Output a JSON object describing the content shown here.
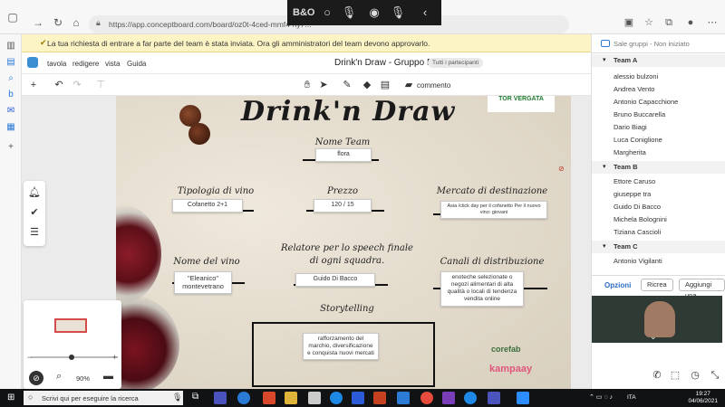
{
  "browser": {
    "url": "https://app.conceptboard.com/board/oz0t-4ced-mmf4-ny7...",
    "media_icons": [
      "bo-logo-icon",
      "dot-icon",
      "mic-icon",
      "record-icon",
      "mic-icon",
      "back-icon"
    ]
  },
  "notice": {
    "text": "La tua richiesta di entrare a far parte del team è stata inviata. Ora gli amministratori del team devono approvarlo."
  },
  "app": {
    "menu": [
      "tavola",
      "redigere",
      "vista",
      "Guida"
    ],
    "board_title": "Drink'n Draw - Gruppo B",
    "team_chip": "Tutti i partecipanti",
    "comment_label": "commento"
  },
  "board": {
    "title": "Drink'n Draw",
    "sections": {
      "nome_team": {
        "label": "Nome Team",
        "value": "flora"
      },
      "tipologia": {
        "label": "Tipologia di vino",
        "value": "Cofanetto 2+1"
      },
      "prezzo": {
        "label": "Prezzo",
        "value": "120 / 15"
      },
      "mercato": {
        "label": "Mercato di destinazione",
        "value": "Asia /click day per il cofanetto Per il nuovo vino: giovani"
      },
      "relatore": {
        "label": "Relatore per lo speech finale di ogni squadra.",
        "value": "Guido Di Bacco"
      },
      "nome_vino": {
        "label": "Nome del vino",
        "value": "\"Eleanico\" montevetrano"
      },
      "canali": {
        "label": "Canali di distribuzione",
        "value": "enoteche selezionate o negozi alimentari di alta qualità o locali di tendenza vendita online"
      },
      "storytelling": {
        "label": "Storytelling",
        "value": "rafforzamento del marchio, diversificazione e conquista nuovi mercati"
      }
    },
    "logo_text": "TOR VERGATA",
    "sponsor1": "corefab",
    "sponsor2": "kampaay"
  },
  "zoom": "90%",
  "panel": {
    "header": "Sale gruppi - Non iniziato",
    "teams": [
      {
        "name": "Team A",
        "members": [
          "alessio bulzoni",
          "Andrea Vento",
          "Antonio Capacchione",
          "Bruno Buccarella",
          "Dario Biagi",
          "Luca Coniglione",
          "Margherita"
        ]
      },
      {
        "name": "Team B",
        "members": [
          "Ettore Caruso",
          "giuseppe tra",
          "Guido Di Bacco",
          "Michela Bolognini",
          "Tiziana Cascioli"
        ]
      },
      {
        "name": "Team C",
        "members": [
          "Antonio Vigilanti"
        ]
      }
    ],
    "options_label": "Opzioni",
    "retry_label": "Ricrea",
    "add_label": "Aggiungi una"
  },
  "taskbar": {
    "search_placeholder": "Scrivi qui per eseguire la ricerca",
    "language": "ITA",
    "time": "19:27",
    "date": "04/06/2021"
  }
}
